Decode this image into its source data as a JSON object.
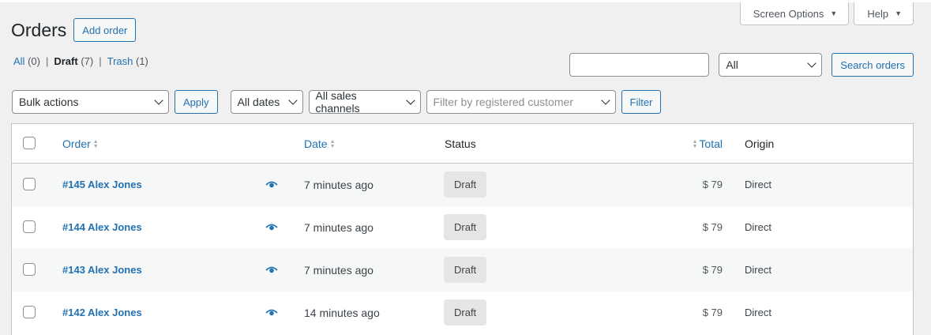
{
  "screen_meta": {
    "screen_options_label": "Screen Options",
    "help_label": "Help"
  },
  "header": {
    "title": "Orders",
    "add_order_label": "Add order"
  },
  "views": {
    "all_label": "All",
    "all_count": "(0)",
    "draft_label": "Draft",
    "draft_count": "(7)",
    "trash_label": "Trash",
    "trash_count": "(1)",
    "separator": "|"
  },
  "search": {
    "input_value": "",
    "status_select": "All",
    "button_label": "Search orders"
  },
  "tablenav": {
    "bulk_actions": "Bulk actions",
    "apply_label": "Apply",
    "dates": "All dates",
    "channels": "All sales channels",
    "customer_placeholder": "Filter by registered customer",
    "filter_label": "Filter"
  },
  "table": {
    "columns": {
      "order": "Order",
      "date": "Date",
      "status": "Status",
      "total": "Total",
      "origin": "Origin"
    },
    "rows": [
      {
        "order": "#145 Alex Jones",
        "date": "7 minutes ago",
        "status": "Draft",
        "total": "$ 79",
        "origin": "Direct"
      },
      {
        "order": "#144 Alex Jones",
        "date": "7 minutes ago",
        "status": "Draft",
        "total": "$ 79",
        "origin": "Direct"
      },
      {
        "order": "#143 Alex Jones",
        "date": "7 minutes ago",
        "status": "Draft",
        "total": "$ 79",
        "origin": "Direct"
      },
      {
        "order": "#142 Alex Jones",
        "date": "14 minutes ago",
        "status": "Draft",
        "total": "$ 79",
        "origin": "Direct"
      }
    ]
  },
  "colors": {
    "link": "#2271b1",
    "background": "#f0f0f1",
    "row_alt": "#f6f7f7",
    "status_badge": "#e5e5e5"
  }
}
